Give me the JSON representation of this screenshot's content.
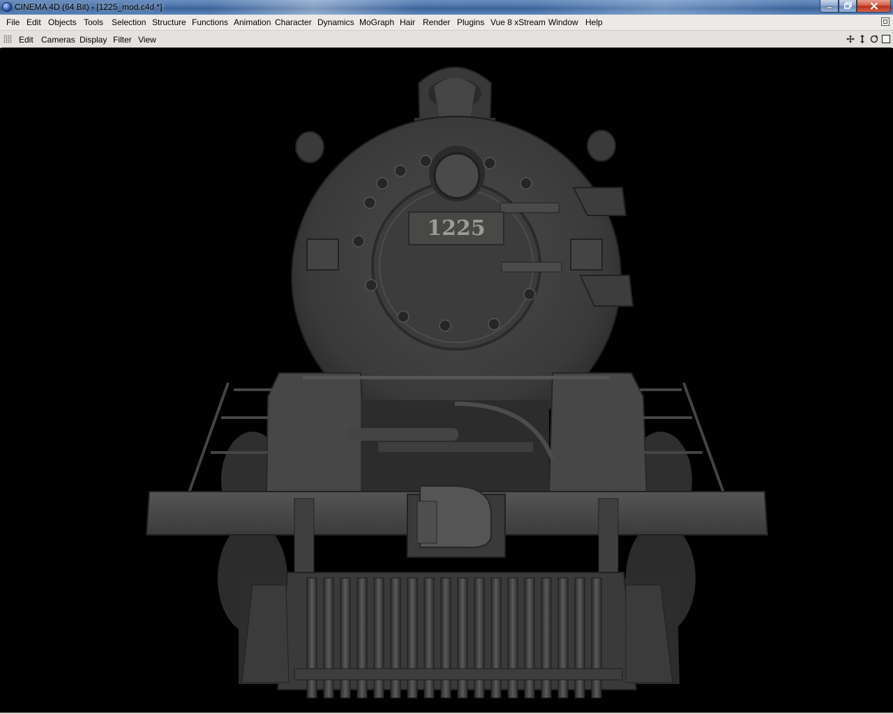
{
  "window": {
    "title": "CINEMA 4D (64 Bit) - [1225_mod.c4d *]",
    "controls": [
      "minimize-icon",
      "restore-icon",
      "close-icon"
    ]
  },
  "menubar": {
    "items": [
      "File",
      "Edit",
      "Objects",
      "Tools",
      "Selection",
      "Structure",
      "Functions",
      "Animation",
      "Character",
      "Dynamics",
      "MoGraph",
      "Hair",
      "Render",
      "Plugins",
      "Vue 8 xStream",
      "Window",
      "Help"
    ]
  },
  "viewport": {
    "menu": [
      "Edit",
      "Cameras",
      "Display",
      "Filter",
      "View"
    ],
    "nav_icons": [
      "move-view-icon",
      "zoom-view-icon",
      "rotate-view-icon",
      "maximize-view-icon"
    ],
    "model": {
      "number_plate": "1225"
    }
  },
  "colors": {
    "titlebar": "#4a72a8",
    "menubar": "#eceae6",
    "viewport_bg": "#000000",
    "model_grey": "#3c3c3c"
  }
}
